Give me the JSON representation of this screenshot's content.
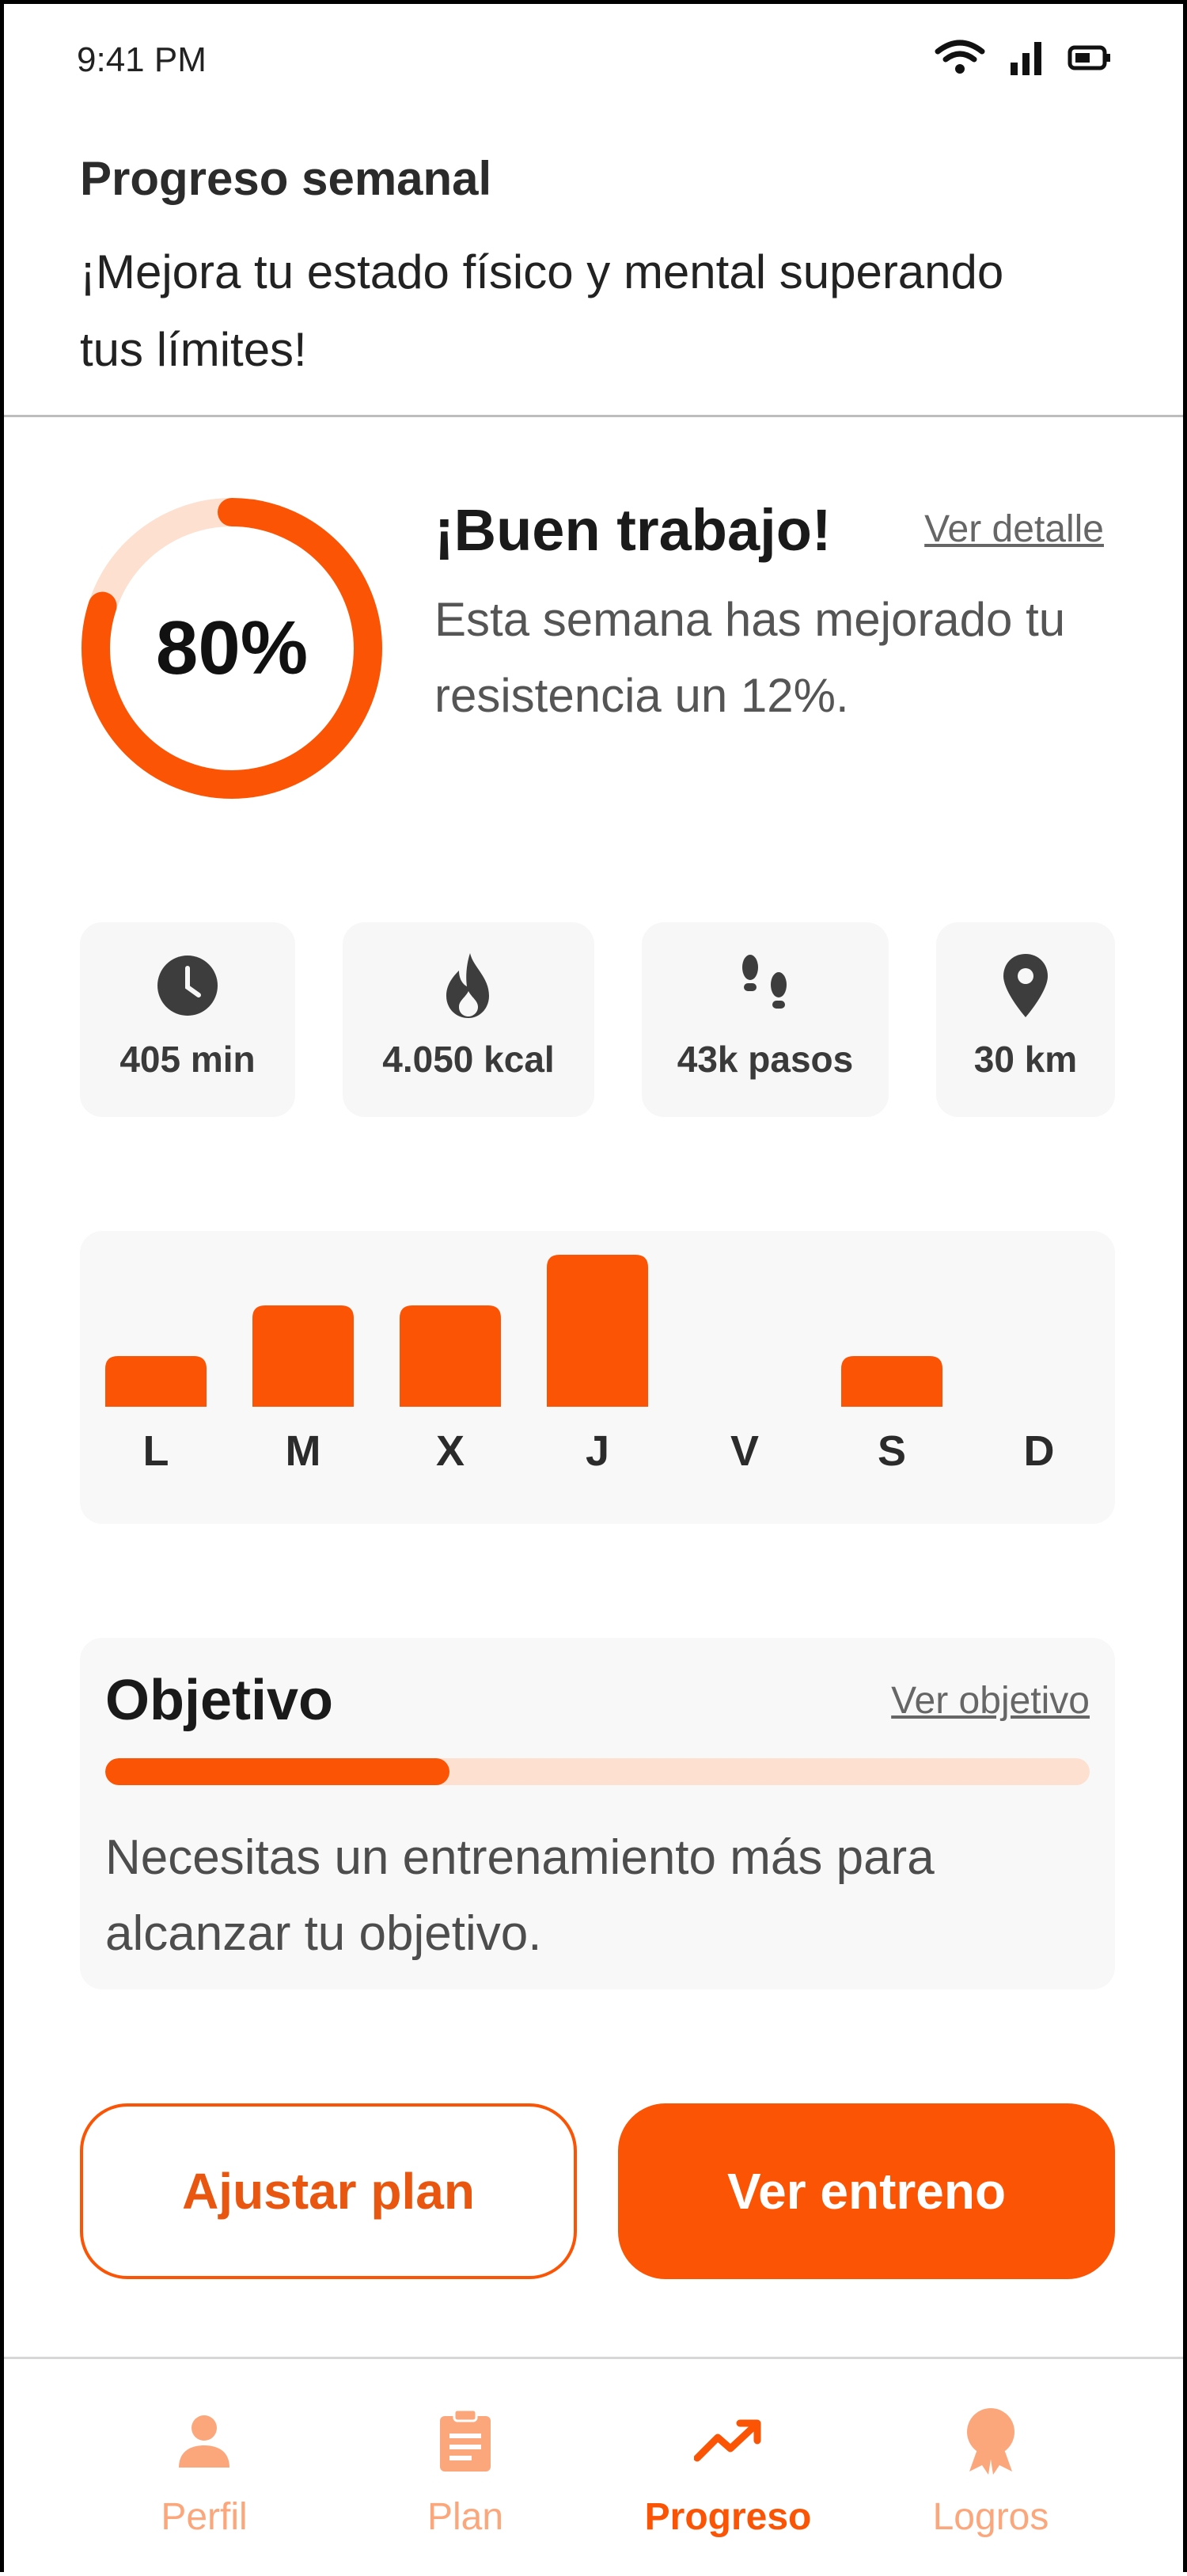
{
  "status_bar": {
    "time": "9:41 PM"
  },
  "header": {
    "title": "Progreso semanal",
    "subtitle": "¡Mejora tu estado físico y mental superando tus límites!"
  },
  "summary": {
    "progress_label": "80%",
    "progress_fraction": 0.8,
    "title": "¡Buen trabajo!",
    "detail_link": "Ver detalle",
    "text": "Esta semana has mejorado tu resistencia un 12%."
  },
  "stats": [
    {
      "icon": "clock-icon",
      "label": "405 min"
    },
    {
      "icon": "flame-icon",
      "label": "4.050 kcal"
    },
    {
      "icon": "footsteps-icon",
      "label": "43k pasos"
    },
    {
      "icon": "location-pin-icon",
      "label": "30 km"
    }
  ],
  "chart_data": {
    "type": "bar",
    "categories": [
      "L",
      "M",
      "X",
      "J",
      "V",
      "S",
      "D"
    ],
    "values": [
      1,
      2,
      2,
      3,
      0,
      1,
      0
    ],
    "ylim": [
      0,
      3
    ],
    "color": "#fb5404"
  },
  "goal": {
    "title": "Objetivo",
    "link": "Ver objetivo",
    "progress_fraction": 0.35,
    "text": "Necesitas un entrenamiento más para alcanzar tu objetivo."
  },
  "buttons": {
    "adjust_label": "Ajustar plan",
    "view_label": "Ver entreno"
  },
  "nav": [
    {
      "icon": "user-icon",
      "label": "Perfil",
      "active": false
    },
    {
      "icon": "clipboard-icon",
      "label": "Plan",
      "active": false
    },
    {
      "icon": "trending-up-icon",
      "label": "Progreso",
      "active": true
    },
    {
      "icon": "medal-icon",
      "label": "Logros",
      "active": false
    }
  ],
  "colors": {
    "accent": "#fb5404",
    "accent_light": "#fde0cf",
    "nav_inactive": "#fca77b",
    "card_bg": "#f7f7f7"
  }
}
